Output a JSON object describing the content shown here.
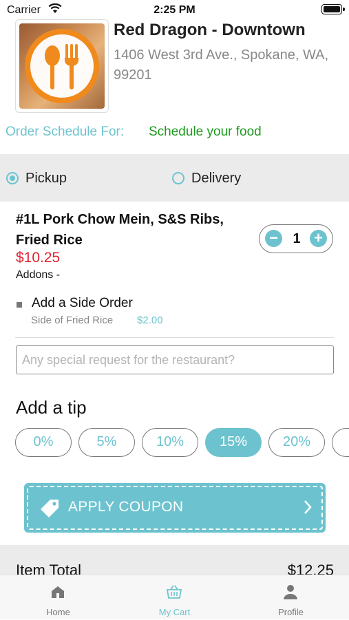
{
  "status_bar": {
    "carrier": "Carrier",
    "time": "2:25 PM"
  },
  "restaurant": {
    "name": "Red Dragon - Downtown",
    "address": "1406 West 3rd Ave., Spokane, WA, 99201"
  },
  "schedule": {
    "label": "Order Schedule For:",
    "value": "Schedule your food"
  },
  "order_mode": {
    "options": [
      {
        "label": "Pickup",
        "selected": true
      },
      {
        "label": "Delivery",
        "selected": false
      }
    ]
  },
  "item": {
    "title": "#1L Pork Chow Mein, S&S Ribs, Fried Rice",
    "price": "$10.25",
    "addons_label": "Addons -",
    "quantity": "1",
    "side_order": {
      "title": "Add a Side Order",
      "name": "Side of Fried Rice",
      "price": "$2.00"
    }
  },
  "special_request": {
    "placeholder": "Any special request for the restaurant?"
  },
  "tip": {
    "title": "Add a tip",
    "options": [
      "0%",
      "5%",
      "10%",
      "15%",
      "20%"
    ],
    "selected": "15%"
  },
  "coupon": {
    "label": "APPLY COUPON"
  },
  "totals": {
    "item_total_label": "Item Total",
    "item_total_value": "$12.25"
  },
  "tabs": [
    {
      "label": "Home",
      "icon": "home-icon",
      "active": false
    },
    {
      "label": "My Cart",
      "icon": "cart-icon",
      "active": true
    },
    {
      "label": "Profile",
      "icon": "profile-icon",
      "active": false
    }
  ],
  "colors": {
    "accent": "#6cc3cf",
    "price": "#e0202e",
    "schedule": "#1e9a1e",
    "logo": "#f08a1c"
  }
}
